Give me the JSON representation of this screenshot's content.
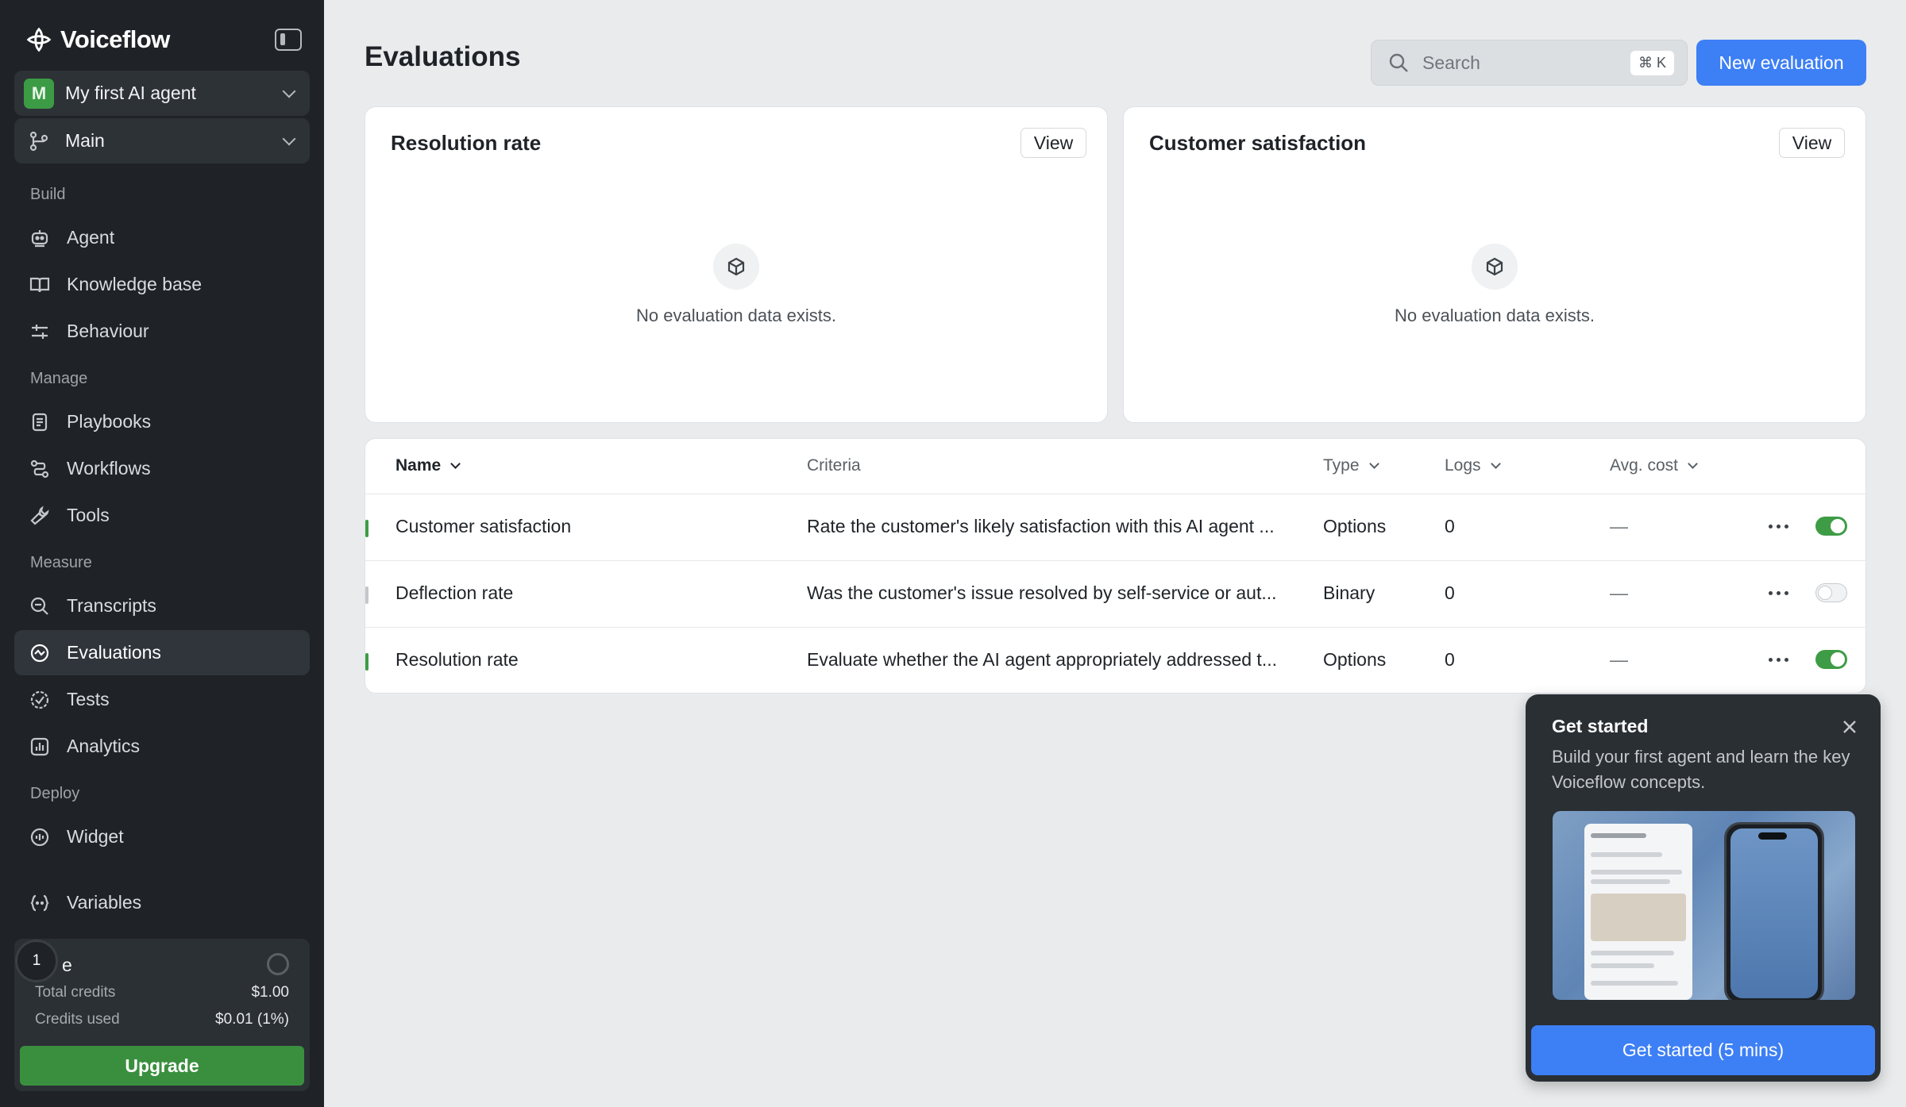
{
  "sidebar": {
    "brand": "Voiceflow",
    "agent": {
      "avatar": "M",
      "name": "My first AI agent"
    },
    "branch": "Main",
    "sections": {
      "build": "Build",
      "manage": "Manage",
      "measure": "Measure",
      "deploy": "Deploy"
    },
    "items": {
      "agent": "Agent",
      "knowledge": "Knowledge base",
      "behaviour": "Behaviour",
      "playbooks": "Playbooks",
      "workflows": "Workflows",
      "tools": "Tools",
      "transcripts": "Transcripts",
      "evaluations": "Evaluations",
      "tests": "Tests",
      "analytics": "Analytics",
      "widget": "Widget",
      "variables": "Variables"
    },
    "credits": {
      "heading": "e",
      "step": "1",
      "total_label": "Total credits",
      "total_value": "$1.00",
      "used_label": "Credits used",
      "used_value": "$0.01 (1%)",
      "upgrade": "Upgrade"
    }
  },
  "header": {
    "title": "Evaluations",
    "search_placeholder": "Search",
    "shortcut": "⌘ K",
    "new_button": "New evaluation"
  },
  "cards": [
    {
      "title": "Resolution rate",
      "view": "View",
      "empty": "No evaluation data exists."
    },
    {
      "title": "Customer satisfaction",
      "view": "View",
      "empty": "No evaluation data exists."
    }
  ],
  "table": {
    "columns": {
      "name": "Name",
      "criteria": "Criteria",
      "type": "Type",
      "logs": "Logs",
      "cost": "Avg. cost"
    },
    "rows": [
      {
        "name": "Customer satisfaction",
        "criteria": "Rate the customer's likely satisfaction with this AI agent ...",
        "type": "Options",
        "logs": "0",
        "cost": "—",
        "enabled": true
      },
      {
        "name": "Deflection rate",
        "criteria": "Was the customer's issue resolved by self-service or aut...",
        "type": "Binary",
        "logs": "0",
        "cost": "—",
        "enabled": false
      },
      {
        "name": "Resolution rate",
        "criteria": "Evaluate whether the AI agent appropriately addressed t...",
        "type": "Options",
        "logs": "0",
        "cost": "—",
        "enabled": true
      }
    ]
  },
  "get_started": {
    "title": "Get started",
    "description": "Build your first agent and learn the key Voiceflow concepts.",
    "button": "Get started (5 mins)"
  },
  "colors": {
    "accent": "#3d7ff5",
    "success": "#3f9c46",
    "sidebar_bg": "#1f2327"
  }
}
